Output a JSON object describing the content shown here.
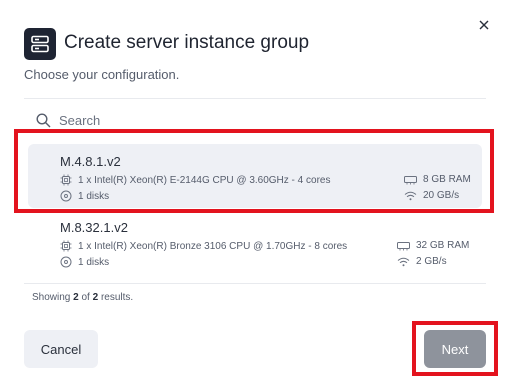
{
  "dialog": {
    "title": "Create server instance group",
    "subtitle": "Choose your configuration.",
    "header_icon": "server-icon",
    "close_icon": "close-icon"
  },
  "search": {
    "placeholder": "Search",
    "value": ""
  },
  "instances": [
    {
      "name": "M.4.8.1.v2",
      "cpu": "1 x Intel(R) Xeon(R) E-2144G CPU @ 3.60GHz - 4 cores",
      "disks": "1 disks",
      "ram": "8 GB RAM",
      "network": "20 GB/s",
      "selected": true
    },
    {
      "name": "M.8.32.1.v2",
      "cpu": "1 x Intel(R) Xeon(R) Bronze 3106 CPU @ 1.70GHz - 8 cores",
      "disks": "1 disks",
      "ram": "32 GB RAM",
      "network": "2 GB/s",
      "selected": false
    }
  ],
  "results": {
    "prefix": "Showing ",
    "shown": "2",
    "middle": " of ",
    "total": "2",
    "suffix": " results."
  },
  "footer": {
    "cancel_label": "Cancel",
    "next_label": "Next"
  },
  "colors": {
    "highlight": "#e3131e",
    "selected_row": "#eef0f5",
    "next_button": "#8e939c"
  }
}
